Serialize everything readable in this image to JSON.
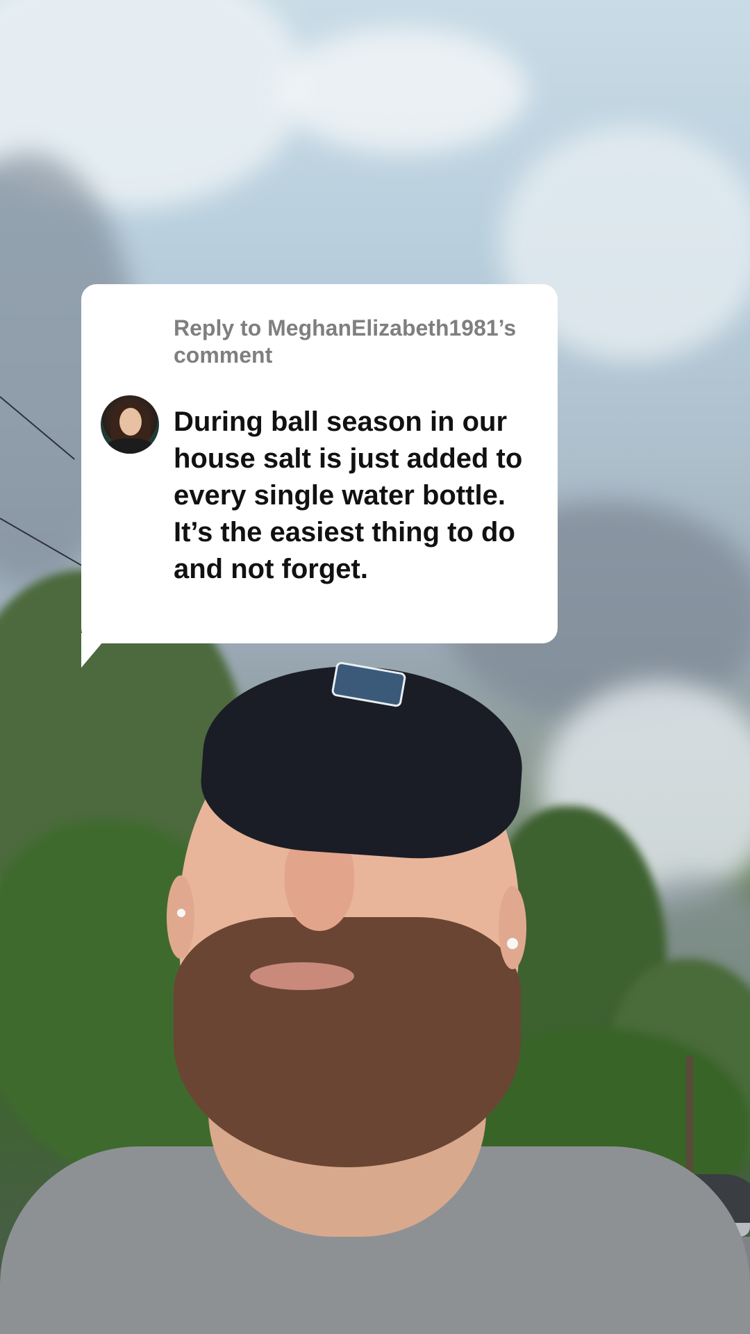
{
  "reply": {
    "header": "Reply to MeghanElizabeth1981’s comment",
    "comment_text": "During ball season in our house salt is just added to every single water bottle. It’s the easiest thing to do and not forget."
  },
  "colors": {
    "bubble_background": "#ffffff",
    "header_text": "#7f7f7f",
    "comment_text": "#111111"
  },
  "icons": {
    "avatar": "commenter-avatar"
  }
}
